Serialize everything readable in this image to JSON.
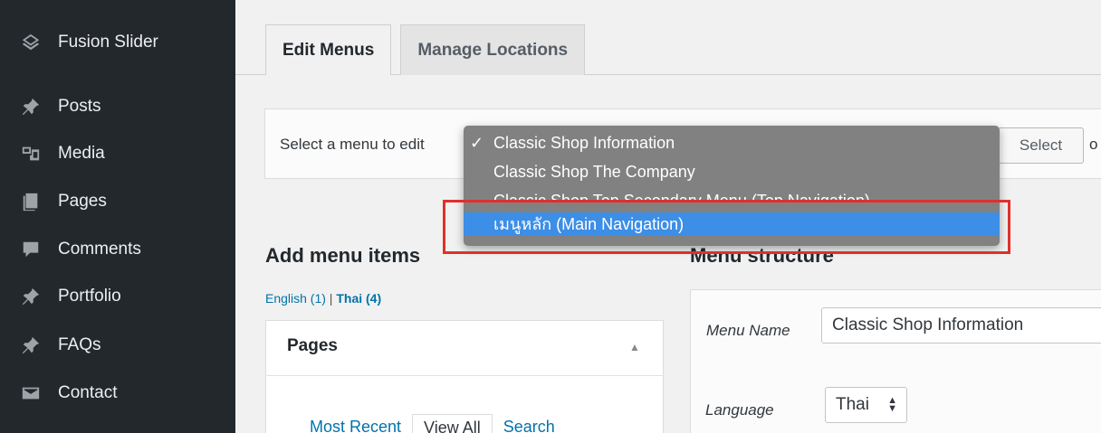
{
  "sidebar": {
    "items": [
      {
        "label": "Fusion Slider",
        "icon": "layers-icon"
      },
      {
        "label": "Posts",
        "icon": "pushpin-icon"
      },
      {
        "label": "Media",
        "icon": "media-icon"
      },
      {
        "label": "Pages",
        "icon": "pages-icon"
      },
      {
        "label": "Comments",
        "icon": "comment-icon"
      },
      {
        "label": "Portfolio",
        "icon": "pushpin-icon"
      },
      {
        "label": "FAQs",
        "icon": "pushpin-icon"
      },
      {
        "label": "Contact",
        "icon": "envelope-icon"
      }
    ]
  },
  "tabs": {
    "edit": "Edit Menus",
    "manage": "Manage Locations"
  },
  "select_bar": {
    "label": "Select a menu to edit",
    "button": "Select",
    "trailing": "o"
  },
  "dropdown": {
    "checkmark": "✓",
    "options": [
      "Classic Shop Information",
      "Classic Shop The Company",
      "Classic Shop Top Secondary Menu (Top Navigation)",
      "เมนูหลัก (Main Navigation)"
    ],
    "selected_index": 0,
    "highlighted_index": 3
  },
  "add_items": {
    "heading": "Add menu items",
    "lang_english": "English (1)",
    "lang_sep": " | ",
    "lang_thai": "Thai (4)",
    "pages_title": "Pages",
    "toggle": "▲",
    "tabs": [
      "Most Recent",
      "View All",
      "Search"
    ]
  },
  "structure": {
    "heading": "Menu structure",
    "menu_name_label": "Menu Name",
    "menu_name_value": "Classic Shop Information",
    "language_label": "Language",
    "language_value": "Thai",
    "language_arrows": "▲▼"
  },
  "colors": {
    "sidebar_bg": "#23282d",
    "link": "#0073aa",
    "highlight": "#3d8ee6",
    "annotation_box": "#e0302b"
  }
}
